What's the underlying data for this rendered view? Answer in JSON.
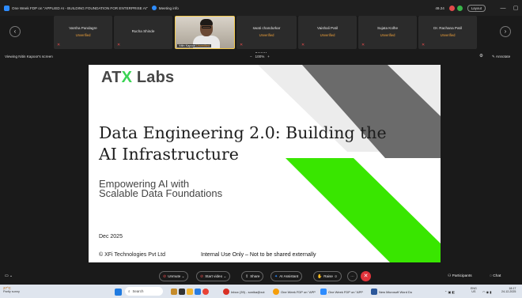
{
  "window": {
    "title": "One Week FDP on \"APPLIED AI - BUILDING FOUNDATION FOR ENTERPRISE AI\"",
    "meeting_info": "Meeting info",
    "kbps": "49.24",
    "layout_button": "Layout",
    "minimize": "—",
    "maximize": "▢"
  },
  "participants_strip": [
    {
      "name": "Varsha Pandagre",
      "status": "Unverified"
    },
    {
      "name": "Rucha Shinde",
      "status": ""
    },
    {
      "name": "Nitin Kapoor",
      "status": "Unverified",
      "active": true
    },
    {
      "name": "swati chandurkar",
      "status": "Unverified"
    },
    {
      "name": "Vaishali Patil",
      "status": "Unverified"
    },
    {
      "name": "Sujata Kolhe",
      "status": "Unverified"
    },
    {
      "name": "Dr. Rachana Patil",
      "status": "Unverified"
    }
  ],
  "share_bar": {
    "viewing": "Viewing Nitin Kapoor's screen",
    "zoom_minus": "−",
    "zoom_level": "100%",
    "zoom_plus": "+",
    "annotate": "Annotate"
  },
  "slide": {
    "logo_prefix": "AT",
    "logo_x": "X",
    "logo_suffix": " Labs",
    "headline_line1": "Data Engineering 2.0: Building the",
    "headline_line2": "AI Infrastructure",
    "subtitle_line1": "Empowering AI with",
    "subtitle_line2": "Scalable Data Foundations",
    "date": "Dec 2025",
    "company": "© XFi Technologies Pvt Ltd",
    "internal_note": "Internal Use Only – Not to be shared externally",
    "colors": {
      "green": "#39e600",
      "gray": "#6b6b6b",
      "light_gray": "#ececec"
    }
  },
  "toolbar": {
    "unmute": "Unmute",
    "start_video": "Start video",
    "share": "Share",
    "ai_assistant": "AI Assistant",
    "raise": "Raise",
    "participants": "Participants",
    "chat": "Chat"
  },
  "taskbar": {
    "weather_temp": "27°C",
    "weather_desc": "Partly sunny",
    "search_placeholder": "Search",
    "apps": [
      {
        "label": "Inbox (39) - sonika@xut",
        "color": "#d93025"
      },
      {
        "label": "One Week FDP on \"APP",
        "color": "#f59e0b"
      },
      {
        "label": "One Week FDP on \"APP",
        "color": "#2d8cff"
      },
      {
        "label": "New Microsoft Word Do",
        "color": "#2b579a"
      }
    ],
    "lang": "ENG",
    "lang_sub": "US",
    "time": "18:17",
    "date": "24-12-2025"
  }
}
